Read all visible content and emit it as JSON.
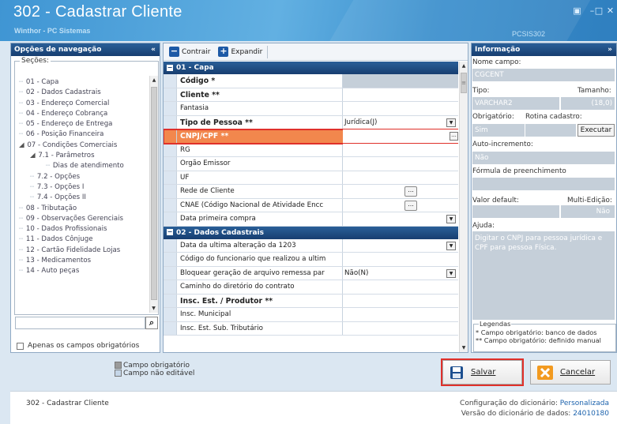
{
  "window": {
    "title": "302 - Cadastrar Cliente",
    "subtitle": "Winthor - PC Sistemas",
    "code": "PCSIS302",
    "accent": "#3f95d3"
  },
  "nav": {
    "header": "Opções de navegação",
    "sections_label": "Seções:",
    "items": [
      {
        "label": "01 - Capa",
        "level": 0
      },
      {
        "label": "02 - Dados Cadastrais",
        "level": 0
      },
      {
        "label": "03 - Endereço Comercial",
        "level": 0
      },
      {
        "label": "04 - Endereço Cobrança",
        "level": 0
      },
      {
        "label": "05 - Endereço de Entrega",
        "level": 0
      },
      {
        "label": "06 - Posição Financeira",
        "level": 0
      },
      {
        "label": "07 - Condições Comerciais",
        "level": 0,
        "expanded": true
      },
      {
        "label": "7.1 - Parâmetros",
        "level": 1,
        "expanded": true
      },
      {
        "label": "Dias de atendimento",
        "level": 2
      },
      {
        "label": "7.2 - Opções",
        "level": 1
      },
      {
        "label": "7.3 - Opções I",
        "level": 1
      },
      {
        "label": "7.4 - Opções II",
        "level": 1
      },
      {
        "label": "08 - Tributação",
        "level": 0
      },
      {
        "label": "09 - Observações Gerenciais",
        "level": 0
      },
      {
        "label": "10 - Dados Profissionais",
        "level": 0
      },
      {
        "label": "11 - Dados Cônjuge",
        "level": 0
      },
      {
        "label": "12 - Cartão Fidelidade Lojas",
        "level": 0
      },
      {
        "label": "13 - Medicamentos",
        "level": 0
      },
      {
        "label": "14 - Auto peças",
        "level": 0
      }
    ],
    "search_value": "",
    "only_required_label": "Apenas os campos obrigatórios"
  },
  "toolbar": {
    "collapse_label": "Contrair",
    "expand_label": "Expandir"
  },
  "grid": {
    "sections": [
      {
        "title": "01 - Capa",
        "rows": [
          {
            "label": "Código *",
            "value": "",
            "bold": true,
            "readonly": true
          },
          {
            "label": "Cliente **",
            "value": "",
            "bold": true,
            "readonly": false
          },
          {
            "label": "Fantasia",
            "value": "",
            "bold": false,
            "readonly": false
          },
          {
            "label": "Tipo de Pessoa **",
            "value": "Jurídica(J)",
            "bold": true,
            "readonly": false,
            "control": "dropdown"
          },
          {
            "label": "CNPJ/CPF **",
            "value": "",
            "bold": true,
            "readonly": false,
            "control": "ellipsis",
            "selected": true
          },
          {
            "label": "RG",
            "value": "",
            "bold": false,
            "readonly": false
          },
          {
            "label": "Orgão Emissor",
            "value": "",
            "bold": false,
            "readonly": false
          },
          {
            "label": "UF",
            "value": "",
            "bold": false,
            "readonly": false
          },
          {
            "label": "Rede de Cliente",
            "value": "",
            "bold": false,
            "readonly": false,
            "control": "lookup"
          },
          {
            "label": "CNAE (Código Nacional de Atividade Encc",
            "value": "",
            "bold": false,
            "readonly": false,
            "control": "lookup"
          },
          {
            "label": "Data primeira compra",
            "value": "",
            "bold": false,
            "readonly": false,
            "control": "dropdown"
          }
        ]
      },
      {
        "title": "02 - Dados Cadastrais",
        "rows": [
          {
            "label": "Data da ultima alteração da 1203",
            "value": "",
            "bold": false,
            "readonly": false,
            "control": "dropdown"
          },
          {
            "label": "Código do funcionario que realizou a ultim",
            "value": "",
            "bold": false,
            "readonly": false
          },
          {
            "label": "Bloquear geração de arquivo remessa par",
            "value": "Não(N)",
            "bold": false,
            "readonly": false,
            "control": "dropdown"
          },
          {
            "label": "Caminho do diretório do contrato",
            "value": "",
            "bold": false,
            "readonly": false
          },
          {
            "label": "Insc. Est. / Produtor **",
            "value": "",
            "bold": true,
            "readonly": false
          },
          {
            "label": "Insc. Municipal",
            "value": "",
            "bold": false,
            "readonly": false
          },
          {
            "label": "Insc. Est. Sub. Tributário",
            "value": "",
            "bold": false,
            "readonly": false
          }
        ]
      }
    ]
  },
  "info": {
    "header": "Informação",
    "field_name_label": "Nome campo:",
    "field_name": "CGCENT",
    "type_label": "Tipo:",
    "type": "VARCHAR2",
    "size_label": "Tamanho:",
    "size": "(18,0)",
    "required_label": "Obrigatório:",
    "required": "Sim",
    "routine_label": "Rotina cadastro:",
    "execute_label": "Executar",
    "autoinc_label": "Auto-incremento:",
    "autoinc": "Não",
    "formula_label": "Fórmula de preenchimento",
    "formula": "",
    "default_label": "Valor default:",
    "default": "",
    "multi_label": "Multi-Edição:",
    "multi": "Não",
    "help_label": "Ajuda:",
    "help": "Digitar o CNPJ para pessoa jurídica e CPF para pessoa Física.",
    "legend_title": "Legendas",
    "legend_1": "* Campo obrigatório: banco de dados",
    "legend_2": "** Campo obrigatório: definido manual"
  },
  "legend_bottom": {
    "required": "Campo obrigatório",
    "not_editable": "Campo não editável"
  },
  "actions": {
    "save": "Salvar",
    "cancel": "Cancelar"
  },
  "status": {
    "left": "302 - Cadastrar Cliente",
    "config_label": "Configuração do dicionário:",
    "config_value": "Personalizada",
    "version_label": "Versão do dicionário de dados:",
    "version_value": "24010180"
  }
}
